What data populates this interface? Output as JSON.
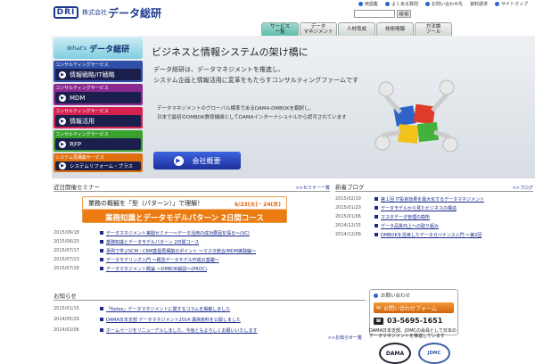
{
  "header": {
    "logo_mark": "DRI",
    "logo_kabu": "株式会社",
    "logo_name": "データ総研",
    "util_links": [
      "用語集",
      "よくある質問",
      "お問い合わせ先",
      "資料請求",
      "サイトマップ"
    ],
    "search_button": "検索"
  },
  "gnav": [
    {
      "label": "サービス\n一覧",
      "active": true
    },
    {
      "label": "データ\nマネジメント",
      "active": false
    },
    {
      "label": "人材育成",
      "active": false
    },
    {
      "label": "技術情報",
      "active": false
    },
    {
      "label": "方法論\nツール",
      "active": false
    }
  ],
  "menu": {
    "head_prefix": "What's",
    "head_title": "データ総研",
    "blocks": [
      {
        "category": "コンサルティングサービス",
        "link": "情報戦略/IT戦略",
        "color": "#2f4fa8"
      },
      {
        "category": "コンサルティングサービス",
        "link": "MDM",
        "color": "#8b2a8e"
      },
      {
        "category": "コンサルティングサービス",
        "link": "情報活用",
        "color": "#d6204f"
      },
      {
        "category": "コンサルティングサービス",
        "link": "RFP",
        "color": "#3aa12e"
      },
      {
        "category": "システム再構築サービス",
        "link": "システムリフォーム・プラス",
        "color": "#e0700d"
      }
    ]
  },
  "hero": {
    "title": "ビジネスと情報システムの架け橋に",
    "p1": "データ総研は、データマネジメントを推進し、",
    "p2": "システム企画と情報活用に変革をもたらすコンサルティングファームです",
    "p3": "データマネジメントのグローバル標準であるDAMA-DMBOKを翻訳し、",
    "p4": "日本で最初のDMBOK教育機関としてDAMAインターナショナルから認可されています",
    "button": "会社概要"
  },
  "seminar": {
    "title": "近日開催セミナー",
    "more": ">>セミナー一覧",
    "banner_top": "業務の概観を「型（パターン）」で理解！",
    "banner_date": "6/23(火)・24(水)",
    "banner_main": "業務知識とデータモデルパターン 2日間コース",
    "items": [
      {
        "date": "2015/06/18",
        "text": "データマネジメント実践セミナー～データ活用の成功要因を探る～(VC)"
      },
      {
        "date": "2015/06/23",
        "text": "業務知識とデータモデルパターン 2日間コース"
      },
      {
        "date": "2015/07/17",
        "text": "事例で学ぶSCM・CRM基盤再構築のポイント ～マスタ統合/MDM実践編～"
      },
      {
        "date": "2015/07/23",
        "text": "データモデリング入門 ～概念データモデル作成の基礎～"
      },
      {
        "date": "2015/07/28",
        "text": "データマネジメント概論 ～DMBOK解説～(PROC)"
      }
    ]
  },
  "blog": {
    "title": "新着ブログ",
    "more": ">>ブログ",
    "items": [
      {
        "date": "2015/02/10",
        "text": "第１回 IT投資効果を最大化するデータマネジメント"
      },
      {
        "date": "2015/01/20",
        "text": "データモデルから見たビジネスの構造"
      },
      {
        "date": "2015/01/06",
        "text": "マスタデータ管理の勘所"
      },
      {
        "date": "2014/12/15",
        "text": "データ品質向上への取り組み"
      },
      {
        "date": "2014/12/09",
        "text": "DMBOKを活用したデータガバナンス入門 ～第2回"
      }
    ]
  },
  "news": {
    "title": "お知らせ",
    "more": ">>お知らせ一覧",
    "items": [
      {
        "date": "2015/01/15",
        "text": "「Notes」データマネジメントに関するコラムを掲載しました"
      },
      {
        "date": "2014/05/29",
        "text": "DAMA日本支部 データマネジメント2014 講演資料を公開しました"
      },
      {
        "date": "2014/02/06",
        "text": "ホームページをリニューアルしました。今後ともよろしくお願いいたします"
      }
    ]
  },
  "contact": {
    "title": "お問い合わせ",
    "form_button": "お問い合わせフォーム",
    "phone": "03-5695-1651",
    "dama_text": "DAMA日本支部、JDMCの会員として日本のデータマネジメントを推進しています",
    "badge1": "DAMA",
    "badge2": "JDMC"
  }
}
